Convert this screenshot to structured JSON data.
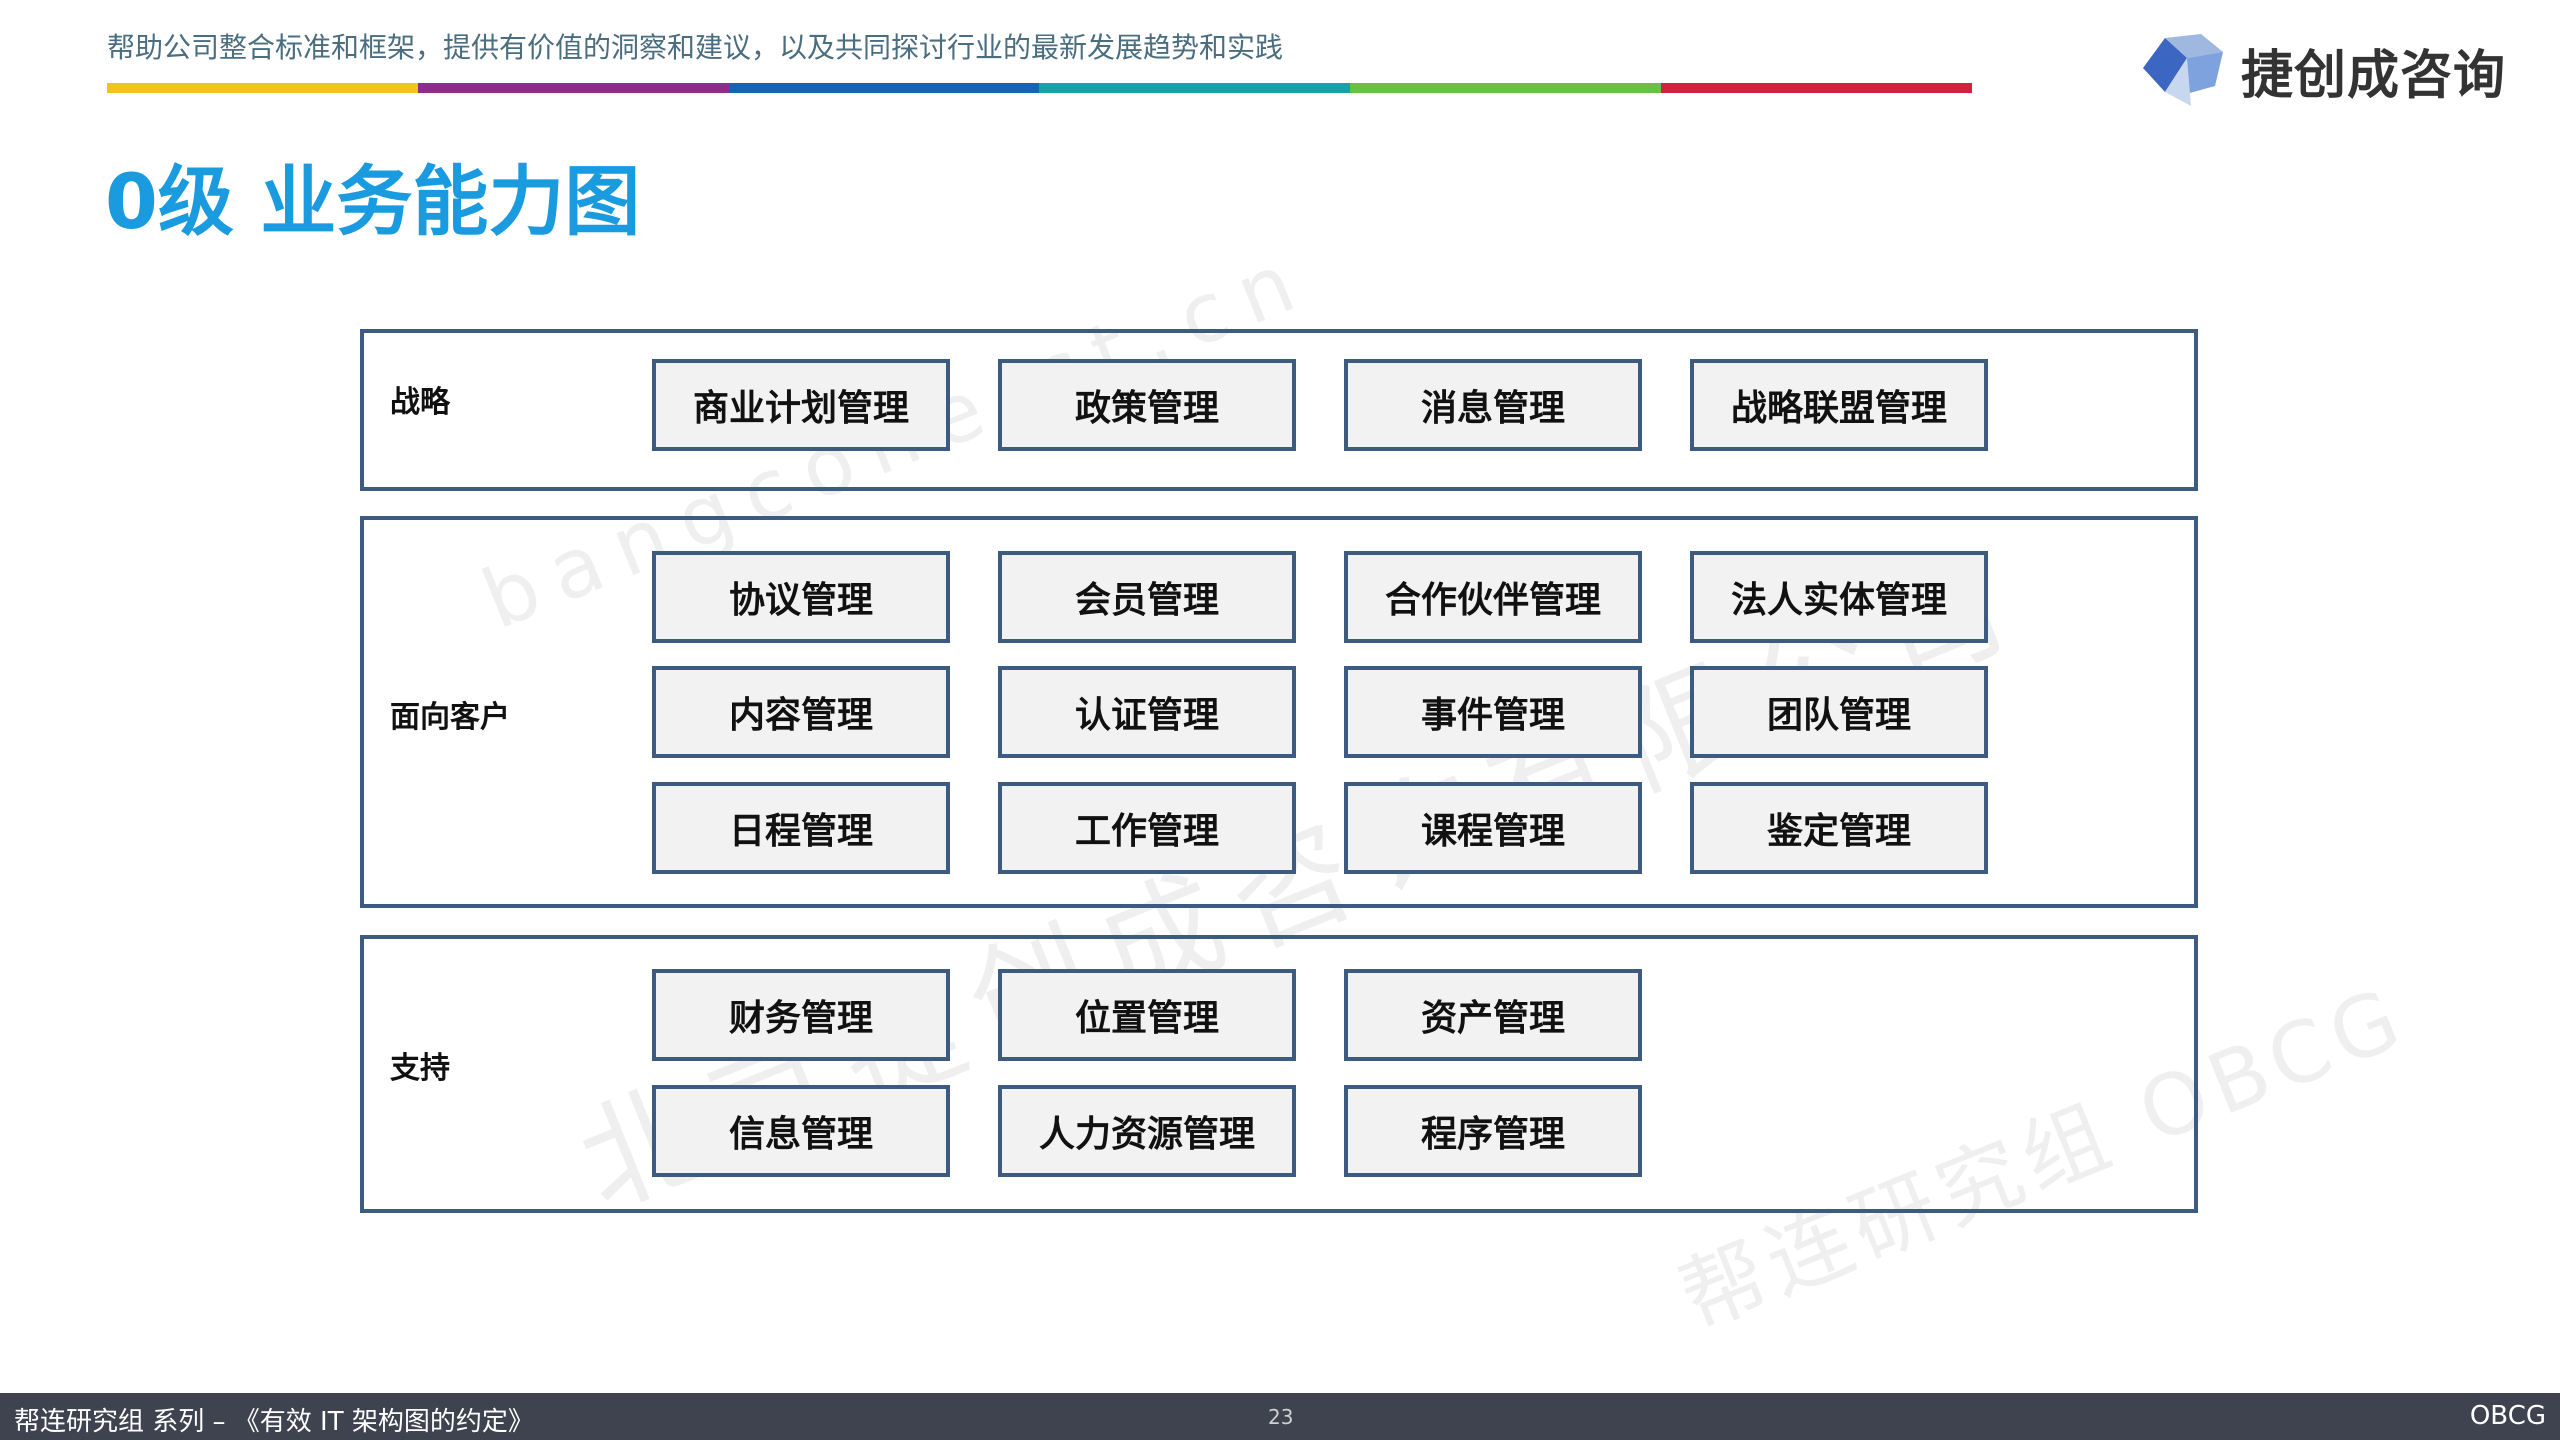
{
  "header": {
    "tagline": "帮助公司整合标准和框架，提供有价值的洞察和建议，以及共同探讨行业的最新发展趋势和实践",
    "color_bar": [
      "#f0c419",
      "#8e2c8c",
      "#1665b4",
      "#16a1a8",
      "#6abf45",
      "#d2203f"
    ],
    "logo_text": "捷创成咨询",
    "accent_color": "#1a9be0",
    "border_color": "#3d5a80"
  },
  "title": "0级 业务能力图",
  "watermarks": [
    "bangcone.ct.cn",
    "北京捷创成咨询有限公司",
    "帮连研究组 OBCG"
  ],
  "layers": [
    {
      "label": "战略",
      "items": [
        "商业计划管理",
        "政策管理",
        "消息管理",
        "战略联盟管理"
      ]
    },
    {
      "label": "面向客户",
      "items": [
        "协议管理",
        "会员管理",
        "合作伙伴管理",
        "法人实体管理",
        "内容管理",
        "认证管理",
        "事件管理",
        "团队管理",
        "日程管理",
        "工作管理",
        "课程管理",
        "鉴定管理"
      ]
    },
    {
      "label": "支持",
      "items": [
        "财务管理",
        "位置管理",
        "资产管理",
        "信息管理",
        "人力资源管理",
        "程序管理"
      ]
    }
  ],
  "footer": {
    "left": "帮连研究组 系列 – 《有效 IT 架构图的约定》",
    "page": "23",
    "right": "OBCG"
  }
}
